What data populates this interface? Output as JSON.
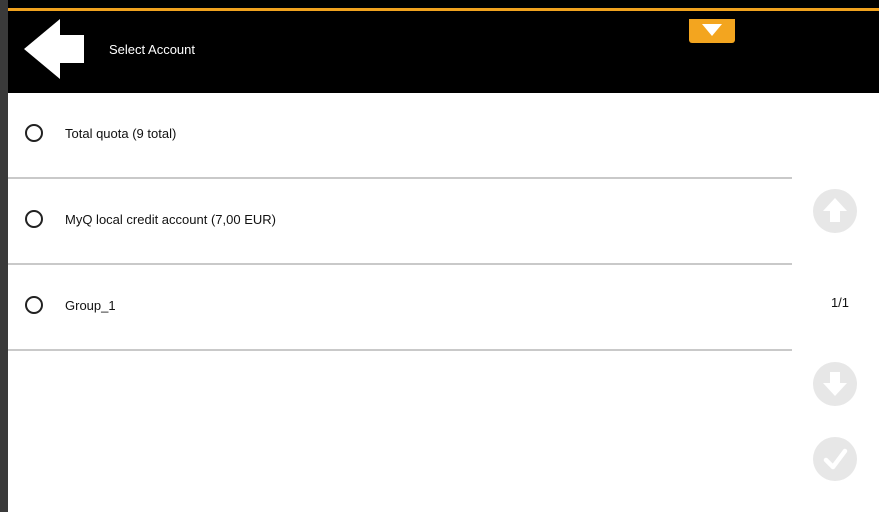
{
  "header": {
    "title": "Select Account",
    "back_icon": "back-arrow-icon",
    "dropdown_icon": "chevron-down-icon"
  },
  "accounts": [
    {
      "label": "Total quota (9 total)",
      "selected": false
    },
    {
      "label": "MyQ local credit account (7,00 EUR)",
      "selected": false
    },
    {
      "label": "Group_1",
      "selected": false
    }
  ],
  "pagination": {
    "indicator": "1/1",
    "up_icon": "arrow-up-icon",
    "down_icon": "arrow-down-icon",
    "confirm_icon": "checkmark-icon"
  },
  "colors": {
    "header_bg": "#000000",
    "accent": "#f3a51f",
    "divider": "#c9c9c9",
    "nav_button_bg": "#e7e7e7",
    "nav_button_icon": "#ffffff"
  }
}
